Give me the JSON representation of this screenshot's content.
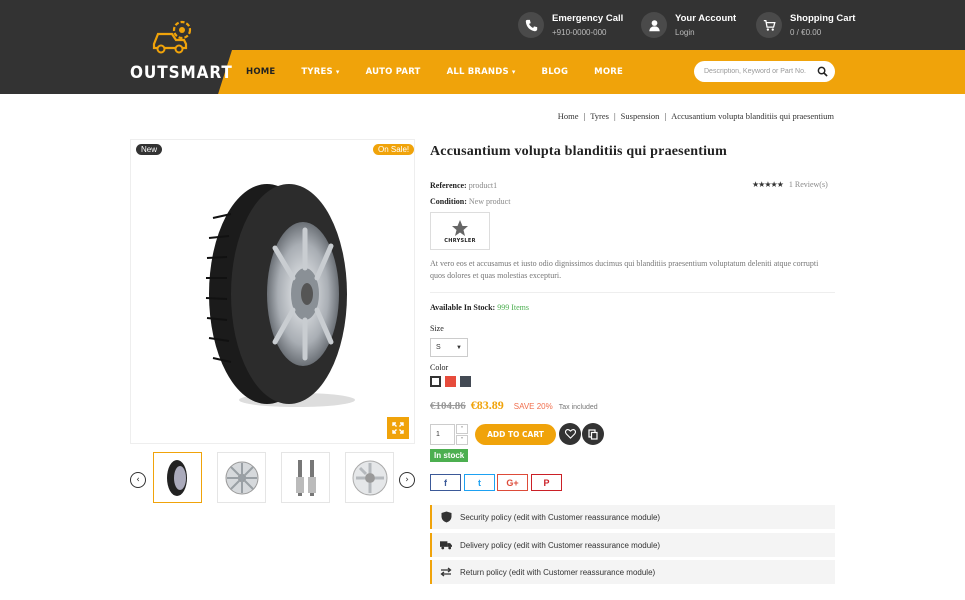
{
  "header": {
    "logo_text": "OUTSMART",
    "emergency": {
      "title": "Emergency Call",
      "value": "+910-0000-000"
    },
    "account": {
      "title": "Your Account",
      "value": "Login"
    },
    "cart": {
      "title": "Shopping Cart",
      "value": "0 / €0.00"
    },
    "nav": [
      {
        "label": "HOME"
      },
      {
        "label": "TYRES"
      },
      {
        "label": "AUTO PART"
      },
      {
        "label": "ALL BRANDS"
      },
      {
        "label": "BLOG"
      },
      {
        "label": "MORE"
      }
    ],
    "search_placeholder": "Description, Keyword or Part No.",
    "colors": {
      "dark": "#333333",
      "accent": "#f0a30a"
    }
  },
  "breadcrumb": [
    "Home",
    "Tyres",
    "Suspension",
    "Accusantium volupta blanditiis qui praesentium"
  ],
  "gallery": {
    "badge_new": "New",
    "badge_sale": "On Sale!",
    "thumbs": [
      "tyre",
      "rim-chrome",
      "shock-absorbers",
      "rim-silver"
    ]
  },
  "product": {
    "title": "Accusantium volupta blanditiis qui praesentium",
    "reference_label": "Reference:",
    "reference": "product1",
    "rating_stars": "★★★★★",
    "reviews": "1 Review(s)",
    "condition_label": "Condition:",
    "condition": "New product",
    "brand": "CHRYSLER",
    "description": "At vero eos et accusamus et iusto odio dignissimos ducimus qui blanditiis praesentium voluptatum deleniti atque corrupti quos dolores et quas molestias excepturi.",
    "stock_label": "Available In Stock:",
    "stock_value": "999 Items",
    "size_label": "Size",
    "size_value": "S",
    "color_label": "Color",
    "colors": [
      "#ffffff",
      "#e74c3c",
      "#434a54"
    ],
    "old_price": "€104.86",
    "price": "€83.89",
    "save": "SAVE 20%",
    "tax": "Tax included",
    "quantity": "1",
    "add_to_cart": "ADD TO CART",
    "in_stock": "In stock",
    "social": [
      "f",
      "t",
      "G+",
      "P"
    ],
    "policies": [
      "Security policy (edit with Customer reassurance module)",
      "Delivery policy (edit with Customer reassurance module)",
      "Return policy (edit with Customer reassurance module)"
    ]
  }
}
